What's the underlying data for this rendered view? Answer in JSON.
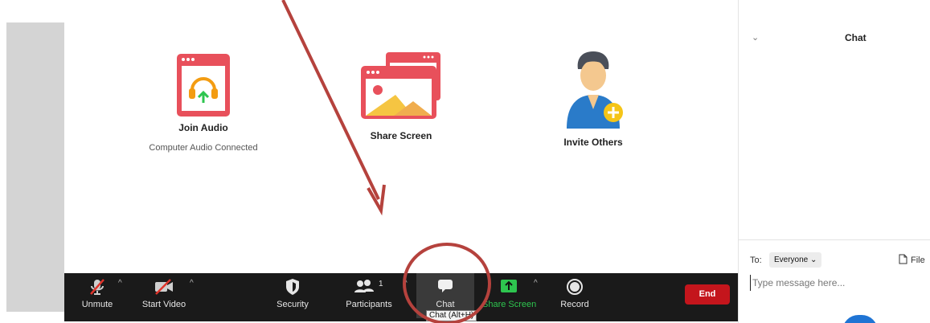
{
  "tiles": {
    "join_audio": {
      "label": "Join Audio",
      "sub": "Computer Audio Connected",
      "icon": "headphones-icon"
    },
    "share_screen": {
      "label": "Share Screen",
      "icon": "share-screen-icon"
    },
    "invite_others": {
      "label": "Invite Others",
      "icon": "invite-user-icon"
    }
  },
  "toolbar": {
    "unmute": "Unmute",
    "start_video": "Start Video",
    "security": "Security",
    "participants": "Participants",
    "participants_count": "1",
    "chat": "Chat",
    "chat_tooltip": "Chat (Alt+H)",
    "share_screen": "Share Screen",
    "record": "Record",
    "end": "End"
  },
  "chat_panel": {
    "title": "Chat",
    "to_label": "To:",
    "recipient": "Everyone",
    "file_label": "File",
    "input_placeholder": "Type message here..."
  },
  "colors": {
    "toolbar_bg": "#1a1a1a",
    "end_red": "#c4151c",
    "share_green": "#2ec54f",
    "annotation_red": "#b5423d",
    "tile_red": "#e8505b"
  }
}
